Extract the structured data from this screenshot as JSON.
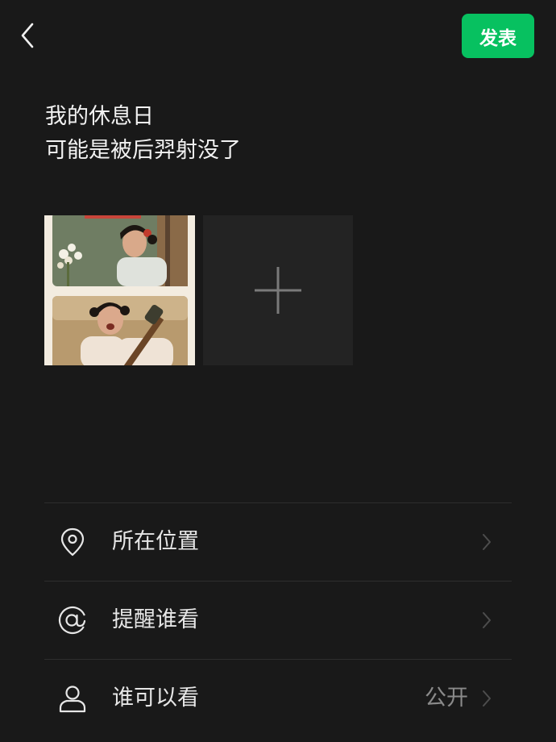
{
  "header": {
    "back_icon": "chevron-left-icon",
    "publish_label": "发表",
    "accent_color": "#07c160"
  },
  "post": {
    "lines": [
      "我的休息日",
      "可能是被后羿射没了"
    ]
  },
  "photos": {
    "items": [
      {
        "description_icon": "photo-thumbnail"
      }
    ],
    "add_icon": "plus-icon"
  },
  "options": [
    {
      "icon": "location-pin-icon",
      "label": "所在位置",
      "value": ""
    },
    {
      "icon": "at-sign-icon",
      "label": "提醒谁看",
      "value": ""
    },
    {
      "icon": "person-icon",
      "label": "谁可以看",
      "value": "公开"
    }
  ]
}
